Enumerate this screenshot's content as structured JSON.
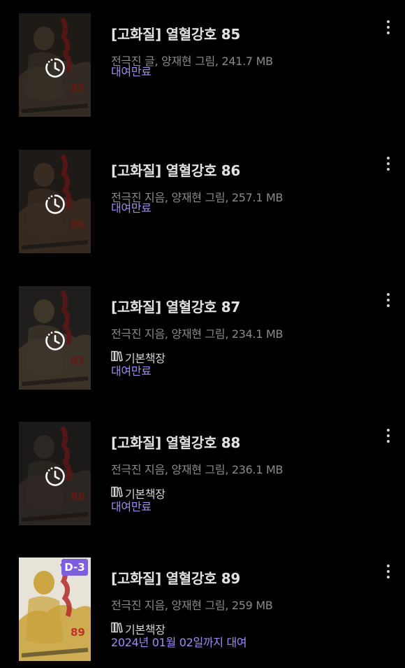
{
  "colors": {
    "background": "#000000",
    "title": "#e2e2e2",
    "meta": "#8a8a8a",
    "shelf": "#d4d4d4",
    "status_accent": "#a08cf0",
    "dday_badge": "#7b5fe0"
  },
  "books": [
    {
      "title": "[고화질] 열혈강호 85",
      "meta": "전극진 글, 양재현 그림, 241.7 MB",
      "shelf": null,
      "status": "대여만료",
      "expired": true,
      "badge": null,
      "cover_icon": "rental-expired-clock-icon",
      "cover_volume": "85",
      "menu_icon": "more-vertical-icon"
    },
    {
      "title": "[고화질] 열혈강호 86",
      "meta": "전극진 지음, 양재현 그림, 257.1 MB",
      "shelf": null,
      "status": "대여만료",
      "expired": true,
      "badge": null,
      "cover_icon": "rental-expired-clock-icon",
      "cover_volume": "86",
      "menu_icon": "more-vertical-icon"
    },
    {
      "title": "[고화질] 열혈강호 87",
      "meta": "전극진 지음, 양재현 그림, 234.1 MB",
      "shelf": "기본책장",
      "status": "대여만료",
      "expired": true,
      "badge": null,
      "cover_icon": "rental-expired-clock-icon",
      "cover_volume": "87",
      "menu_icon": "more-vertical-icon"
    },
    {
      "title": "[고화질] 열혈강호 88",
      "meta": "전극진 지음, 양재현 그림, 236.1 MB",
      "shelf": "기본책장",
      "status": "대여만료",
      "expired": true,
      "badge": null,
      "cover_icon": "rental-expired-clock-icon",
      "cover_volume": "88",
      "menu_icon": "more-vertical-icon"
    },
    {
      "title": "[고화질] 열혈강호 89",
      "meta": "전극진 지음, 양재현 그림, 259 MB",
      "shelf": "기본책장",
      "status": "2024년 01월 02일까지 대여",
      "expired": false,
      "badge": "D-3",
      "cover_icon": null,
      "cover_volume": "89",
      "menu_icon": "more-vertical-icon"
    }
  ]
}
